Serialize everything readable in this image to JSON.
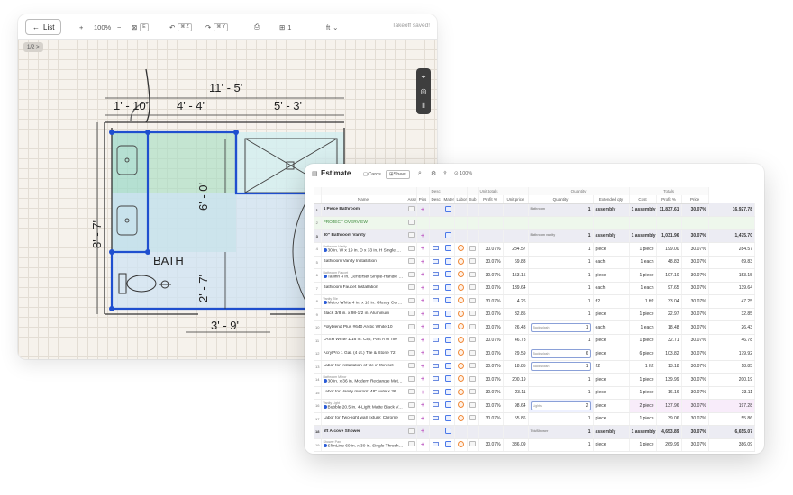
{
  "takeoff": {
    "list_label": "List",
    "zoom": "100%",
    "zoom_in": "+",
    "zoom_out": "−",
    "fit_kbd": "E",
    "undo_kbd": "⌘ Z",
    "redo_kbd": "⌘ Y",
    "page_number": "1",
    "unit": "ft",
    "status": "Takeoff saved!",
    "page_badge": "1/2 >",
    "plan": {
      "dims": [
        "11' - 5'",
        "1' - 10'",
        "4' - 4'",
        "5' - 3'",
        "6' - 0'",
        "8' - 7'",
        "2' - 7'",
        "3' - 9'"
      ],
      "room_label": "BATH"
    }
  },
  "estimate": {
    "title": "Estimate",
    "tabs": [
      "Cards",
      "Sheet"
    ],
    "zoom": "100%",
    "group_headers": {
      "desc": "Desc",
      "unit_totals": "Unit totals",
      "quantity": "Quantity",
      "totals": "Totals"
    },
    "columns": [
      "Name",
      "Assem",
      "Pics",
      "Desc",
      "Material",
      "Labor",
      "Sub",
      "Profit %",
      "Unit price",
      "Quantity",
      "Extended qty",
      "Cost",
      "Profit %",
      "Price"
    ],
    "rows": [
      {
        "n": "1",
        "type": "group",
        "name": "4 Piece Bathroom",
        "profit": "",
        "unit_price": "",
        "qlabel": "Bathroom",
        "qty": "1",
        "qunit": "assembly",
        "ext": "1",
        "eunit": "assembly",
        "cost": "11,837.61",
        "profit2": "30.07%",
        "price": "16,927.78"
      },
      {
        "n": "2",
        "type": "overview",
        "name": "PROJECT OVERVIEW",
        "profit": "",
        "unit_price": "",
        "qlabel": "",
        "qty": "",
        "qunit": "",
        "ext": "",
        "eunit": "",
        "cost": "",
        "profit2": "",
        "price": ""
      },
      {
        "n": "3",
        "type": "group",
        "name": "30\" Bathroom Vanity",
        "profit": "",
        "unit_price": "",
        "qlabel": "Bathroom vanity",
        "qty": "1",
        "qunit": "assembly",
        "ext": "1",
        "eunit": "assembly",
        "cost": "1,031.96",
        "profit2": "30.07%",
        "price": "1,475.70"
      },
      {
        "n": "4",
        "type": "item",
        "small": "Bathroom Vanity",
        "name": "30 in. W x 19 in. D x 33 in. H Single Sink Bath",
        "profit": "30.07%",
        "unit_price": "284.57",
        "qlabel": "",
        "qty": "1",
        "qunit": "piece",
        "ext": "1",
        "eunit": "piece",
        "cost": "199.00",
        "profit2": "30.07%",
        "price": "284.57"
      },
      {
        "n": "5",
        "type": "item",
        "small": "",
        "name": "Bathroom Vanity Installation",
        "profit": "30.07%",
        "unit_price": "69.83",
        "qlabel": "",
        "qty": "1",
        "qunit": "each",
        "ext": "1",
        "eunit": "each",
        "cost": "48.83",
        "profit2": "30.07%",
        "price": "69.83"
      },
      {
        "n": "6",
        "type": "item",
        "small": "Bathroom Faucet",
        "name": "Tallinn 4 in. Centerset Single-Handle Bathroom",
        "profit": "30.07%",
        "unit_price": "153.15",
        "qlabel": "",
        "qty": "1",
        "qunit": "piece",
        "ext": "1",
        "eunit": "piece",
        "cost": "107.10",
        "profit2": "30.07%",
        "price": "153.15"
      },
      {
        "n": "7",
        "type": "item",
        "small": "",
        "name": "Bathroom Faucet Installation",
        "profit": "30.07%",
        "unit_price": "139.64",
        "qlabel": "",
        "qty": "1",
        "qunit": "each",
        "ext": "1",
        "eunit": "each",
        "cost": "97.65",
        "profit2": "30.07%",
        "price": "139.64"
      },
      {
        "n": "8",
        "type": "item",
        "small": "Vanity Tile",
        "name": "Metro White 4 in. x 16 in. Glossy Ceramic",
        "profit": "30.07%",
        "unit_price": "4.26",
        "qlabel": "",
        "qty": "1",
        "qunit": "ft2",
        "ext": "1",
        "eunit": "ft2",
        "cost": "33.04",
        "profit2": "30.07%",
        "price": "47.25"
      },
      {
        "n": "9",
        "type": "item",
        "small": "",
        "name": "Black 3/8 in. x 98-1/2 in. Aluminum",
        "profit": "30.07%",
        "unit_price": "32.85",
        "qlabel": "",
        "qty": "1",
        "qunit": "piece",
        "ext": "1",
        "eunit": "piece",
        "cost": "22.97",
        "profit2": "30.07%",
        "price": "32.85"
      },
      {
        "n": "10",
        "type": "item",
        "small": "",
        "name": "Polyblend Plus #640 Arctic White 10",
        "profit": "30.07%",
        "unit_price": "26.43",
        "qlabel": "Backsplash",
        "qty": "1",
        "qunit": "each",
        "ext": "1",
        "eunit": "each",
        "cost": "18.48",
        "profit2": "30.07%",
        "price": "26.43",
        "box": true
      },
      {
        "n": "11",
        "type": "item",
        "small": "",
        "name": "LASH White 1/16 in. Clip, Part A of Tile",
        "profit": "30.07%",
        "unit_price": "46.78",
        "qlabel": "",
        "qty": "1",
        "qunit": "piece",
        "ext": "1",
        "eunit": "piece",
        "cost": "32.71",
        "profit2": "30.07%",
        "price": "46.78"
      },
      {
        "n": "12",
        "type": "item",
        "small": "",
        "name": "AcrylPro 1 Gal. (4 qt.) Tile & Stone 72",
        "profit": "30.07%",
        "unit_price": "29.59",
        "qlabel": "Backsplash",
        "qty": "6",
        "qunit": "piece",
        "ext": "6",
        "eunit": "piece",
        "cost": "103.82",
        "profit2": "30.07%",
        "price": "179.92",
        "box": true
      },
      {
        "n": "13",
        "type": "item",
        "small": "",
        "name": "Labor for Installation of tile in thin set",
        "profit": "30.07%",
        "unit_price": "18.85",
        "qlabel": "Backsplash",
        "qty": "1",
        "qunit": "ft2",
        "ext": "1",
        "eunit": "ft2",
        "cost": "13.18",
        "profit2": "30.07%",
        "price": "18.85",
        "box": true
      },
      {
        "n": "14",
        "type": "item",
        "small": "Bathroom Mirror",
        "name": "30 in. x 36 in. Modern Rectangle Metal Framed",
        "profit": "30.07%",
        "unit_price": "200.19",
        "qlabel": "",
        "qty": "1",
        "qunit": "piece",
        "ext": "1",
        "eunit": "piece",
        "cost": "139.99",
        "profit2": "30.07%",
        "price": "200.19"
      },
      {
        "n": "15",
        "type": "item",
        "small": "",
        "name": "Labor for Vanity mirrors: 48\" wide x 36",
        "profit": "30.07%",
        "unit_price": "23.11",
        "qlabel": "",
        "qty": "1",
        "qunit": "piece",
        "ext": "1",
        "eunit": "piece",
        "cost": "16.16",
        "profit2": "30.07%",
        "price": "23.11"
      },
      {
        "n": "16",
        "type": "item",
        "small": "Vanity Light",
        "name": "Bubble 20.5 in. 4-Light Matte Black Vanity",
        "profit": "30.07%",
        "unit_price": "98.64",
        "qlabel": "Lights",
        "qty": "2",
        "qunit": "piece",
        "ext": "2",
        "eunit": "piece",
        "cost": "137.96",
        "profit2": "30.07%",
        "price": "197.28",
        "box": true,
        "hl": true
      },
      {
        "n": "17",
        "type": "item",
        "small": "",
        "name": "Labor for Two-light wall fixture: Chrome",
        "profit": "30.07%",
        "unit_price": "55.86",
        "qlabel": "",
        "qty": "1",
        "qunit": "piece",
        "ext": "1",
        "eunit": "piece",
        "cost": "39.06",
        "profit2": "30.07%",
        "price": "55.86"
      },
      {
        "n": "18",
        "type": "group",
        "name": "5ft Alcove Shower",
        "profit": "",
        "unit_price": "",
        "qlabel": "Tub/Shower",
        "qty": "1",
        "qunit": "assembly",
        "ext": "1",
        "eunit": "assembly",
        "cost": "4,653.89",
        "profit2": "30.07%",
        "price": "6,655.07"
      },
      {
        "n": "19",
        "type": "item",
        "small": "Shower Pan",
        "name": "SlimLine 60 in. x 30 in. Single Threshold",
        "profit": "30.07%",
        "unit_price": "386.09",
        "qlabel": "",
        "qty": "1",
        "qunit": "piece",
        "ext": "1",
        "eunit": "piece",
        "cost": "269.99",
        "profit2": "30.07%",
        "price": "386.09"
      }
    ]
  }
}
